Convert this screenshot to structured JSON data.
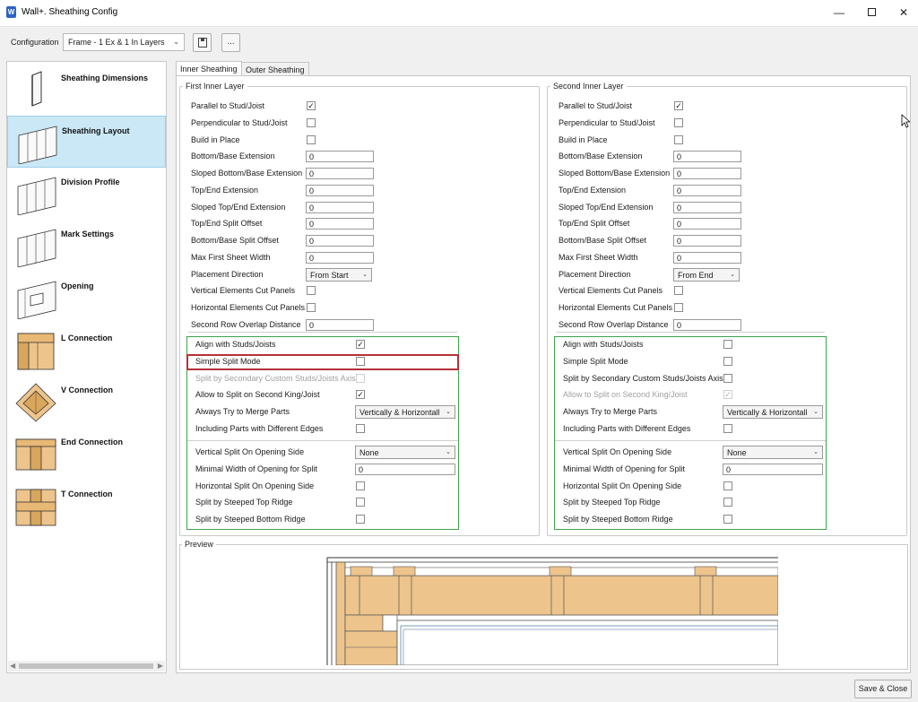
{
  "window": {
    "title": "Wall+. Sheathing Config"
  },
  "config": {
    "label": "Configuration",
    "value": "Frame - 1 Ex & 1 In Layers",
    "more_label": "..."
  },
  "sidebar": {
    "items": [
      {
        "label": "Sheathing Dimensions",
        "icon": "sheet-icon"
      },
      {
        "label": "Sheathing Layout",
        "icon": "wall-panels-icon",
        "active": true
      },
      {
        "label": "Division Profile",
        "icon": "wall-panels-icon"
      },
      {
        "label": "Mark Settings",
        "icon": "wall-panels-icon"
      },
      {
        "label": "Opening",
        "icon": "wall-opening-icon"
      },
      {
        "label": "L Connection",
        "icon": "l-connection-icon"
      },
      {
        "label": "V Connection",
        "icon": "v-connection-icon"
      },
      {
        "label": "End Connection",
        "icon": "end-connection-icon"
      },
      {
        "label": "T Connection",
        "icon": "t-connection-icon"
      }
    ]
  },
  "tabs": [
    {
      "label": "Inner Sheathing",
      "active": true
    },
    {
      "label": "Outer Sheathing",
      "active": false
    }
  ],
  "first": {
    "title": "First Inner Layer",
    "fields": [
      {
        "label": "Parallel to Stud/Joist",
        "type": "cb",
        "checked": true
      },
      {
        "label": "Perpendicular to Stud/Joist",
        "type": "cb",
        "checked": false
      },
      {
        "label": "Build in Place",
        "type": "cb",
        "checked": false
      },
      {
        "label": "Bottom/Base Extension",
        "type": "text",
        "value": "0"
      },
      {
        "label": "Sloped Bottom/Base Extension",
        "type": "text",
        "value": "0"
      },
      {
        "label": "Top/End Extension",
        "type": "text",
        "value": "0"
      },
      {
        "label": "Sloped Top/End Extension",
        "type": "text",
        "value": "0"
      },
      {
        "label": "Top/End Split Offset",
        "type": "text",
        "value": "0"
      },
      {
        "label": "Bottom/Base Split Offset",
        "type": "text",
        "value": "0"
      },
      {
        "label": "Max First Sheet Width",
        "type": "text",
        "value": "0"
      },
      {
        "label": "Placement Direction",
        "type": "dd",
        "value": "From Start"
      },
      {
        "label": "Vertical Elements Cut Panels",
        "type": "cb",
        "checked": false
      },
      {
        "label": "Horizontal Elements Cut Panels",
        "type": "cb",
        "checked": false
      },
      {
        "label": "Second Row Overlap Distance",
        "type": "text",
        "value": "0"
      }
    ],
    "split": [
      {
        "label": "Align with Studs/Joists",
        "type": "cb",
        "checked": true
      },
      {
        "label": "Simple Split Mode",
        "type": "cb",
        "checked": false
      },
      {
        "label": "Split by Secondary Custom Studs/Joists Axis",
        "type": "cb",
        "checked": false,
        "disabled": true
      },
      {
        "label": "Allow to Split on Second King/Joist",
        "type": "cb",
        "checked": true
      },
      {
        "label": "Always Try to Merge Parts",
        "type": "dd",
        "value": "Vertically & Horizontall"
      },
      {
        "label": "Including Parts with Different Edges",
        "type": "cb",
        "checked": false
      }
    ],
    "opening": [
      {
        "label": "Vertical Split On Opening Side",
        "type": "dd",
        "value": "None"
      },
      {
        "label": "Minimal Width of Opening for Split",
        "type": "text",
        "value": "0"
      },
      {
        "label": "Horizontal Split On Opening Side",
        "type": "cb",
        "checked": false
      },
      {
        "label": "Split by Steeped Top Ridge",
        "type": "cb",
        "checked": false
      },
      {
        "label": "Split by Steeped Bottom Ridge",
        "type": "cb",
        "checked": false
      }
    ]
  },
  "second": {
    "title": "Second Inner Layer",
    "fields": [
      {
        "label": "Parallel to Stud/Joist",
        "type": "cb",
        "checked": true
      },
      {
        "label": "Perpendicular to Stud/Joist",
        "type": "cb",
        "checked": false
      },
      {
        "label": "Build in Place",
        "type": "cb",
        "checked": false
      },
      {
        "label": "Bottom/Base Extension",
        "type": "text",
        "value": "0"
      },
      {
        "label": "Sloped Bottom/Base Extension",
        "type": "text",
        "value": "0"
      },
      {
        "label": "Top/End Extension",
        "type": "text",
        "value": "0"
      },
      {
        "label": "Sloped Top/End Extension",
        "type": "text",
        "value": "0"
      },
      {
        "label": "Top/End Split Offset",
        "type": "text",
        "value": "0"
      },
      {
        "label": "Bottom/Base Split Offset",
        "type": "text",
        "value": "0"
      },
      {
        "label": "Max First Sheet Width",
        "type": "text",
        "value": "0"
      },
      {
        "label": "Placement Direction",
        "type": "dd",
        "value": "From End"
      },
      {
        "label": "Vertical Elements Cut Panels",
        "type": "cb",
        "checked": false
      },
      {
        "label": "Horizontal Elements Cut Panels",
        "type": "cb",
        "checked": false
      },
      {
        "label": "Second Row Overlap Distance",
        "type": "text",
        "value": "0"
      }
    ],
    "split": [
      {
        "label": "Align with Studs/Joists",
        "type": "cb",
        "checked": false
      },
      {
        "label": "Simple Split Mode",
        "type": "cb",
        "checked": false
      },
      {
        "label": "Split by Secondary Custom Studs/Joists Axis",
        "type": "cb",
        "checked": false
      },
      {
        "label": "Allow to Split on Second King/Joist",
        "type": "cb",
        "checked": true,
        "disabled": true
      },
      {
        "label": "Always Try to Merge Parts",
        "type": "dd",
        "value": "Vertically & Horizontall"
      },
      {
        "label": "Including Parts with Different Edges",
        "type": "cb",
        "checked": false
      }
    ],
    "opening": [
      {
        "label": "Vertical Split On Opening Side",
        "type": "dd",
        "value": "None"
      },
      {
        "label": "Minimal Width of Opening for Split",
        "type": "text",
        "value": "0"
      },
      {
        "label": "Horizontal Split On Opening Side",
        "type": "cb",
        "checked": false
      },
      {
        "label": "Split by Steeped Top Ridge",
        "type": "cb",
        "checked": false
      },
      {
        "label": "Split by Steeped Bottom Ridge",
        "type": "cb",
        "checked": false
      }
    ]
  },
  "preview": {
    "title": "Preview"
  },
  "footer": {
    "save_close": "Save & Close"
  },
  "colors": {
    "selection": "#cbe8f6",
    "group_border": "#3fa34d",
    "highlight": "#b5313a",
    "wood": "#edc48c"
  }
}
